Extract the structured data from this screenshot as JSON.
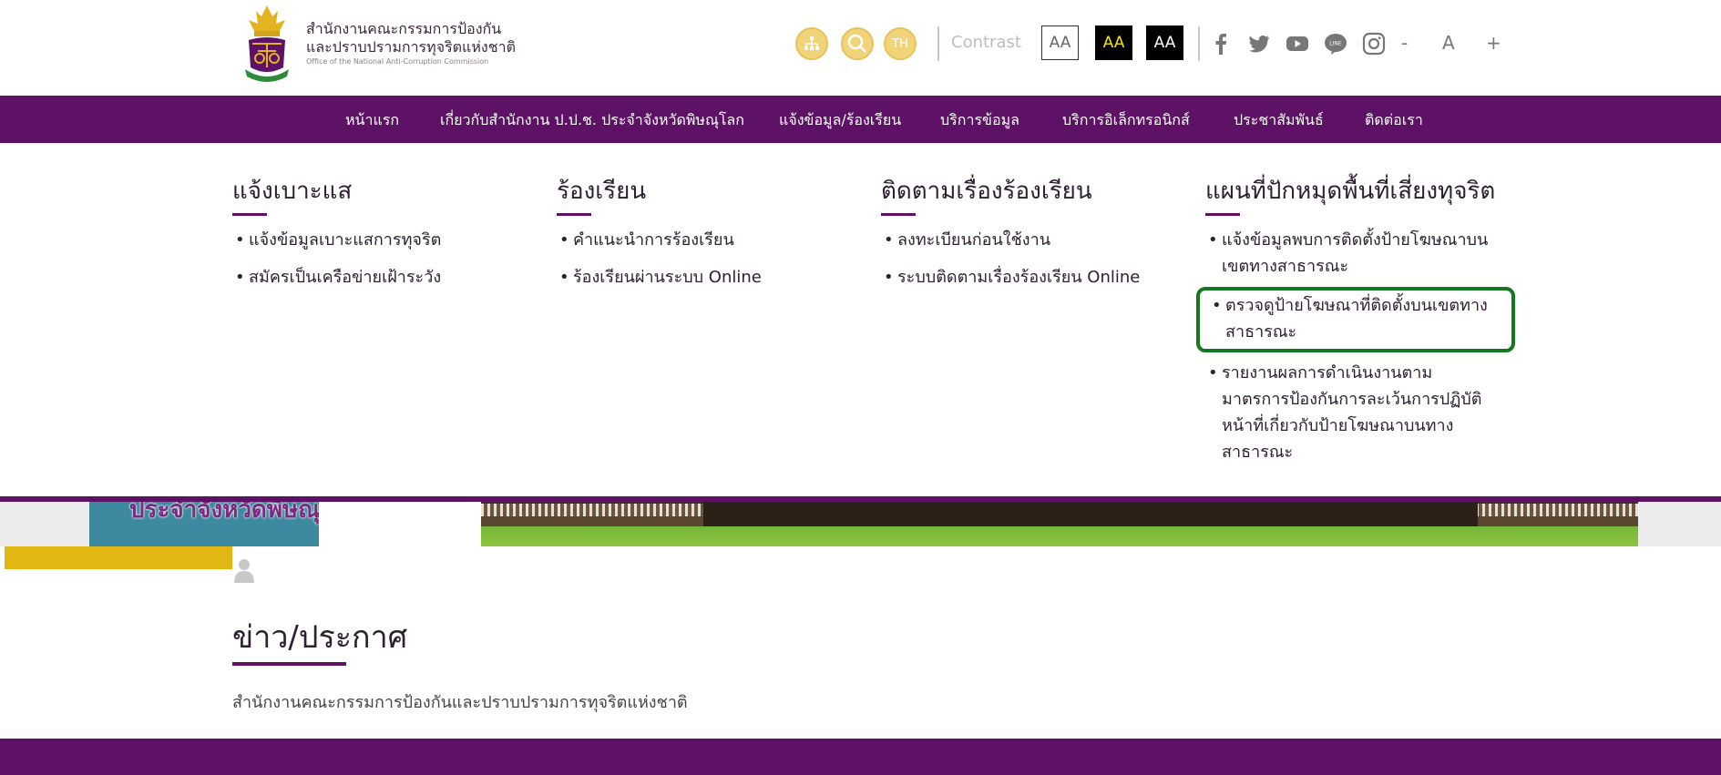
{
  "header": {
    "org_name_line1": "สำนักงานคณะกรรมการป้องกัน",
    "org_name_line2": "และปราบปรามการทุจริตแห่งชาติ",
    "org_name_en": "Office of the National Anti-Corruption Commission",
    "sitemap_icon": "sitemap-icon",
    "search_icon": "search-icon",
    "lang_label": "TH",
    "contrast_label": "Contrast",
    "contrast_options": [
      "AA",
      "AA",
      "AA"
    ],
    "social_icons": [
      "facebook-icon",
      "twitter-icon",
      "youtube-icon",
      "line-icon",
      "instagram-icon"
    ],
    "font_size_controls": [
      "-",
      "A",
      "+"
    ]
  },
  "nav": {
    "items": [
      "หน้าแรก",
      "เกี่ยวกับสำนักงาน ป.ป.ช. ประจำจังหวัดพิษณุโลก",
      "แจ้งข้อมูล/ร้องเรียน",
      "บริการข้อมูล",
      "บริการอิเล็กทรอนิกส์",
      "ประชาสัมพันธ์",
      "ติดต่อเรา"
    ]
  },
  "mega_menu": {
    "columns": [
      {
        "title": "แจ้งเบาะแส",
        "items": [
          "แจ้งข้อมูลเบาะแสการทุจริต",
          "สมัครเป็นเครือข่ายเฝ้าระวัง"
        ]
      },
      {
        "title": "ร้องเรียน",
        "items": [
          "คำแนะนำการร้องเรียน",
          "ร้องเรียนผ่านระบบ Online"
        ]
      },
      {
        "title": "ติดตามเรื่องร้องเรียน",
        "items": [
          "ลงทะเบียนก่อนใช้งาน",
          "ระบบติดตามเรื่องร้องเรียน Online"
        ]
      },
      {
        "title": "แผนที่ปักหมุดพื้นที่เสี่ยงทุจริต",
        "items": [
          "แจ้งข้อมูลพบการติดตั้งป้ายโฆษณาบนเขตทางสาธารณะ",
          "ตรวจดูป้ายโฆษณาที่ติดตั้งบนเขตทางสาธารณะ",
          "รายงานผลการดำเนินงานตามมาตรการป้องกันการละเว้นการปฏิบัติหน้าที่เกี่ยวกับป้ายโฆษณาบนทางสาธารณะ"
        ],
        "highlighted_index": 1
      }
    ]
  },
  "banner": {
    "text": "ประจำจังหวัดพิษณุโลก"
  },
  "news": {
    "title": "ข่าว/ประกาศ",
    "subtitle": "สำนักงานคณะกรรมการป้องกันและปราบปรามการทุจริตแห่งชาติ"
  },
  "colors": {
    "primary_purple": "#5e1266",
    "gold": "#e2b714",
    "highlight_green": "#13791f"
  }
}
